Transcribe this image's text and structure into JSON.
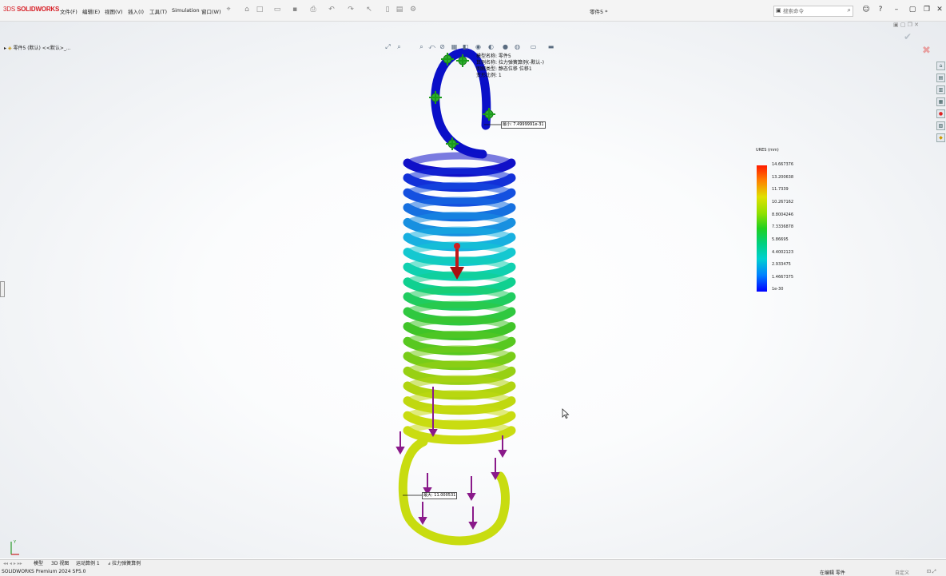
{
  "app": {
    "logo_prefix": "3DS",
    "logo_text": "SOLIDWORKS",
    "document_title": "零件5 *",
    "status_app": "SOLIDWORKS Premium 2024 SP5.0"
  },
  "menu": [
    "文件(F)",
    "编辑(E)",
    "视图(V)",
    "插入(I)",
    "工具(T)",
    "Simulation",
    "窗口(W)"
  ],
  "search": {
    "placeholder": "搜索命令"
  },
  "feature_tree": {
    "item": "零件5 (默认) <<默认>_..."
  },
  "study_info": {
    "model_name": "模型名称: 零件5",
    "study_name": "算例名称: 拉力弹簧算例(-默认-)",
    "plot_type": "图解类型: 静态位移 位移1",
    "deformation": "变形比例: 1"
  },
  "legend": {
    "title": "URES (mm)",
    "ticks": [
      "14.667376",
      "13.200638",
      "11.7339",
      "10.267162",
      "8.8004246",
      "7.3336878",
      "5.86695",
      "4.4002123",
      "2.933475",
      "1.4667375",
      "1e-30"
    ],
    "colors": {
      "max": "#ff1a00",
      "mid": "#20d020",
      "min": "#0000ff"
    }
  },
  "annotations": {
    "min_label": "最小: 7.4999991e-31",
    "max_label": "最大: 11.000531"
  },
  "bottom_tabs": [
    "模型",
    "3D 视图",
    "运动算例 1",
    "拉力弹簧算例"
  ],
  "status": {
    "editing": "在编辑 零件",
    "custom": "自定义"
  }
}
